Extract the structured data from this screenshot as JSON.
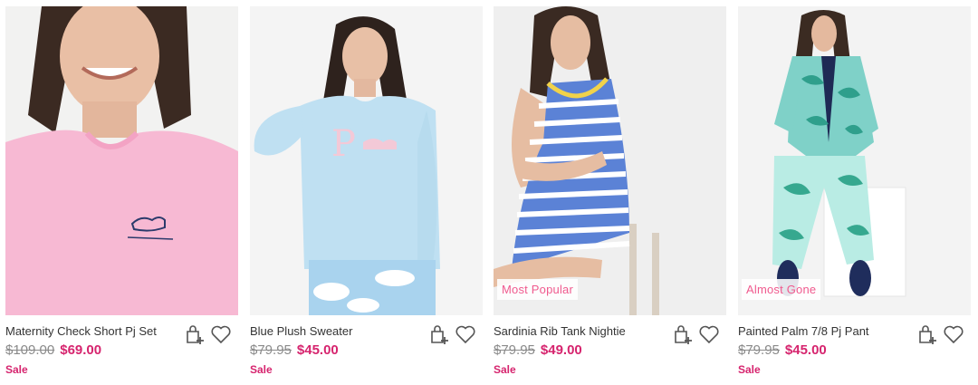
{
  "products": [
    {
      "name": "Maternity Check Short Pj Set",
      "was_price": "$109.00",
      "now_price": "$69.00",
      "sale_label": "Sale",
      "badge": "",
      "image_icon": "model-pink-tee-photo"
    },
    {
      "name": "Blue Plush Sweater",
      "was_price": "$79.95",
      "now_price": "$45.00",
      "sale_label": "Sale",
      "badge": "",
      "image_icon": "model-blue-sweater-photo"
    },
    {
      "name": "Sardinia Rib Tank Nightie",
      "was_price": "$79.95",
      "now_price": "$49.00",
      "sale_label": "Sale",
      "badge": "Most Popular",
      "image_icon": "model-striped-nightie-photo"
    },
    {
      "name": "Painted Palm 7/8 Pj Pant",
      "was_price": "$79.95",
      "now_price": "$45.00",
      "sale_label": "Sale",
      "badge": "Almost Gone",
      "image_icon": "model-palm-pj-photo"
    }
  ],
  "icons": {
    "add_to_bag": "bag-plus-icon",
    "wishlist": "heart-icon"
  },
  "colors": {
    "sale_price": "#d6246e",
    "badge_text": "#f05a8e",
    "was_price": "#8a8a8a"
  }
}
